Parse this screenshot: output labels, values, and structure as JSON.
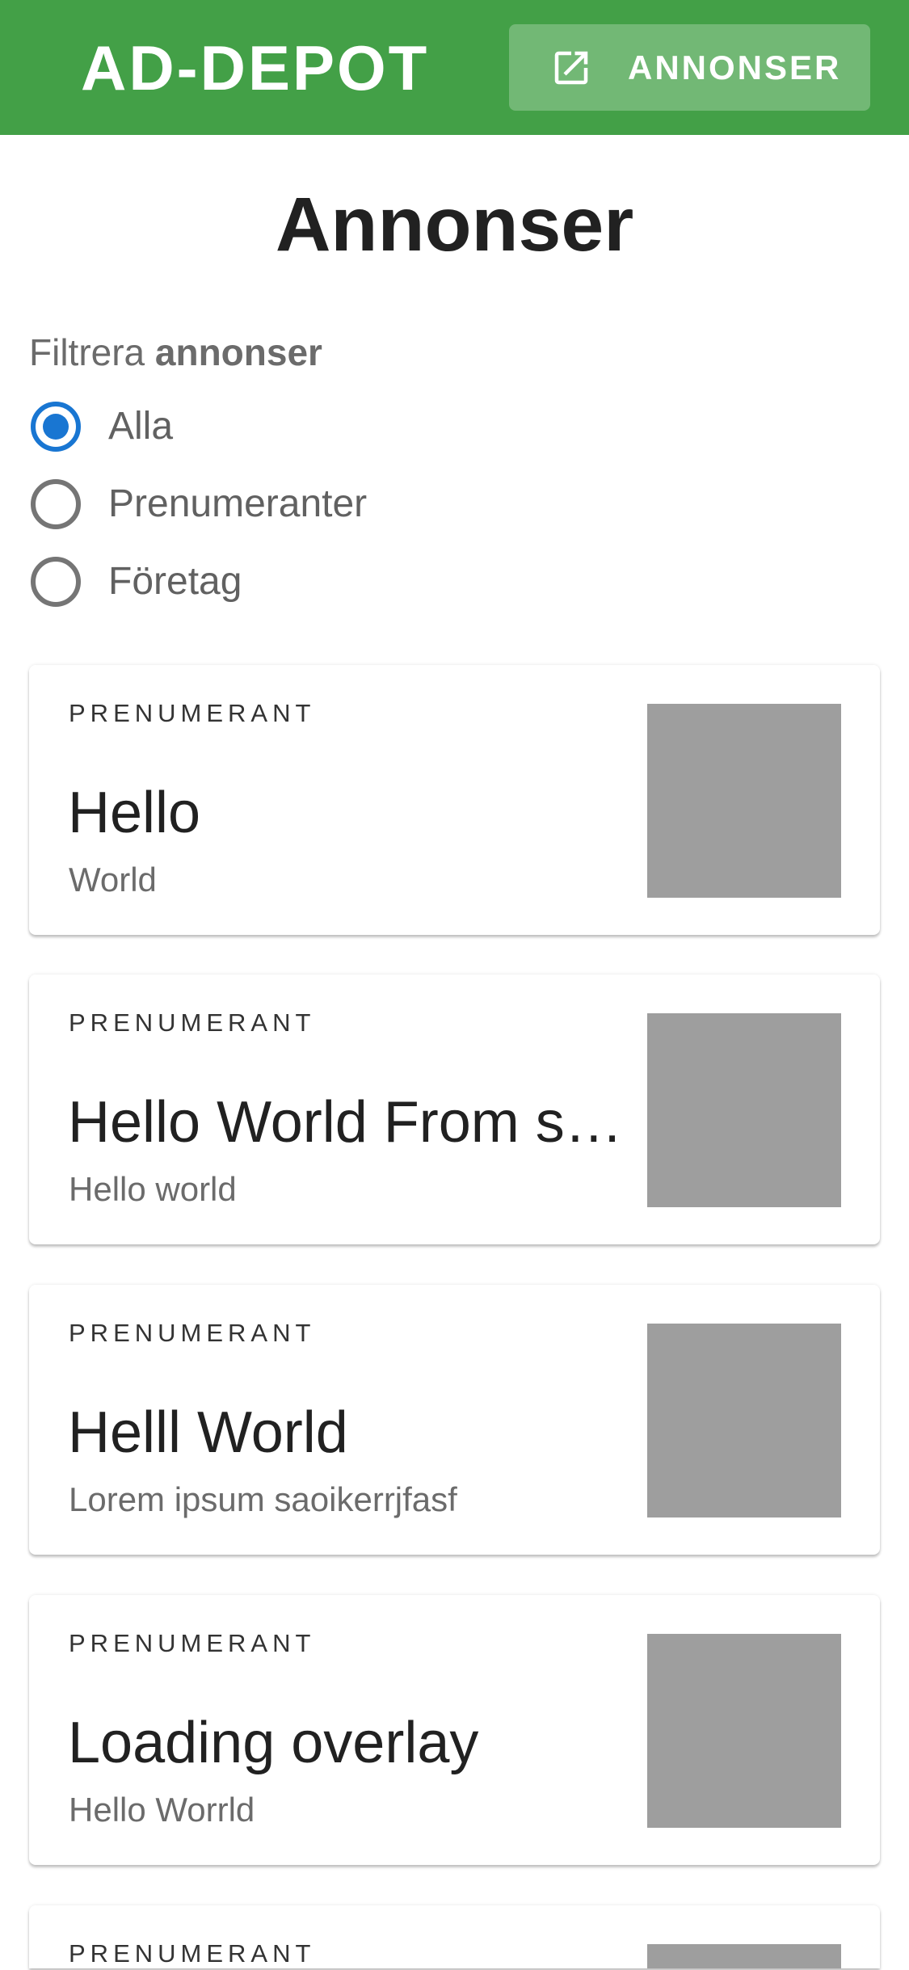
{
  "header": {
    "brand": "AD-DEPOT",
    "nav_button_label": "ANNONSER",
    "nav_button_icon": "open-in-new-icon",
    "background_color": "#43a047"
  },
  "page": {
    "title": "Annonser"
  },
  "filter": {
    "legend_prefix": "Filtrera",
    "legend_bold": "annonser",
    "options": [
      {
        "label": "Alla",
        "checked": true
      },
      {
        "label": "Prenumeranter",
        "checked": false
      },
      {
        "label": "Företag",
        "checked": false
      }
    ],
    "accent_color": "#1976d2"
  },
  "ads": [
    {
      "overline": "PRENUMERANT",
      "title": "Hello",
      "subtitle": "World"
    },
    {
      "overline": "PRENUMERANT",
      "title": "Hello World From s…",
      "subtitle": "Hello world"
    },
    {
      "overline": "PRENUMERANT",
      "title": "Helll World",
      "subtitle": "Lorem ipsum saoikerrjfasf"
    },
    {
      "overline": "PRENUMERANT",
      "title": "Loading overlay",
      "subtitle": "Hello Worrld"
    },
    {
      "overline": "PRENUMERANT",
      "title": "",
      "subtitle": ""
    }
  ]
}
